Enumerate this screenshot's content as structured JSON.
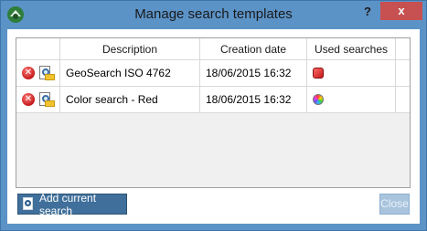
{
  "window": {
    "title": "Manage search templates",
    "help_label": "?",
    "close_label": "x"
  },
  "grid": {
    "columns": [
      "",
      "Description",
      "Creation date",
      "Used searches",
      ""
    ],
    "rows": [
      {
        "description": "GeoSearch ISO 4762",
        "creation_date": "18/06/2015 16:32",
        "used_icon": "red-cube-icon"
      },
      {
        "description": "Color search - Red",
        "creation_date": "18/06/2015 16:32",
        "used_icon": "color-wheel-icon"
      }
    ]
  },
  "buttons": {
    "add_label": "Add current search",
    "close_label": "Close"
  },
  "colors": {
    "frame": "#5b93c7",
    "accent_button": "#3f6f9a",
    "delete": "#c41a1a"
  }
}
